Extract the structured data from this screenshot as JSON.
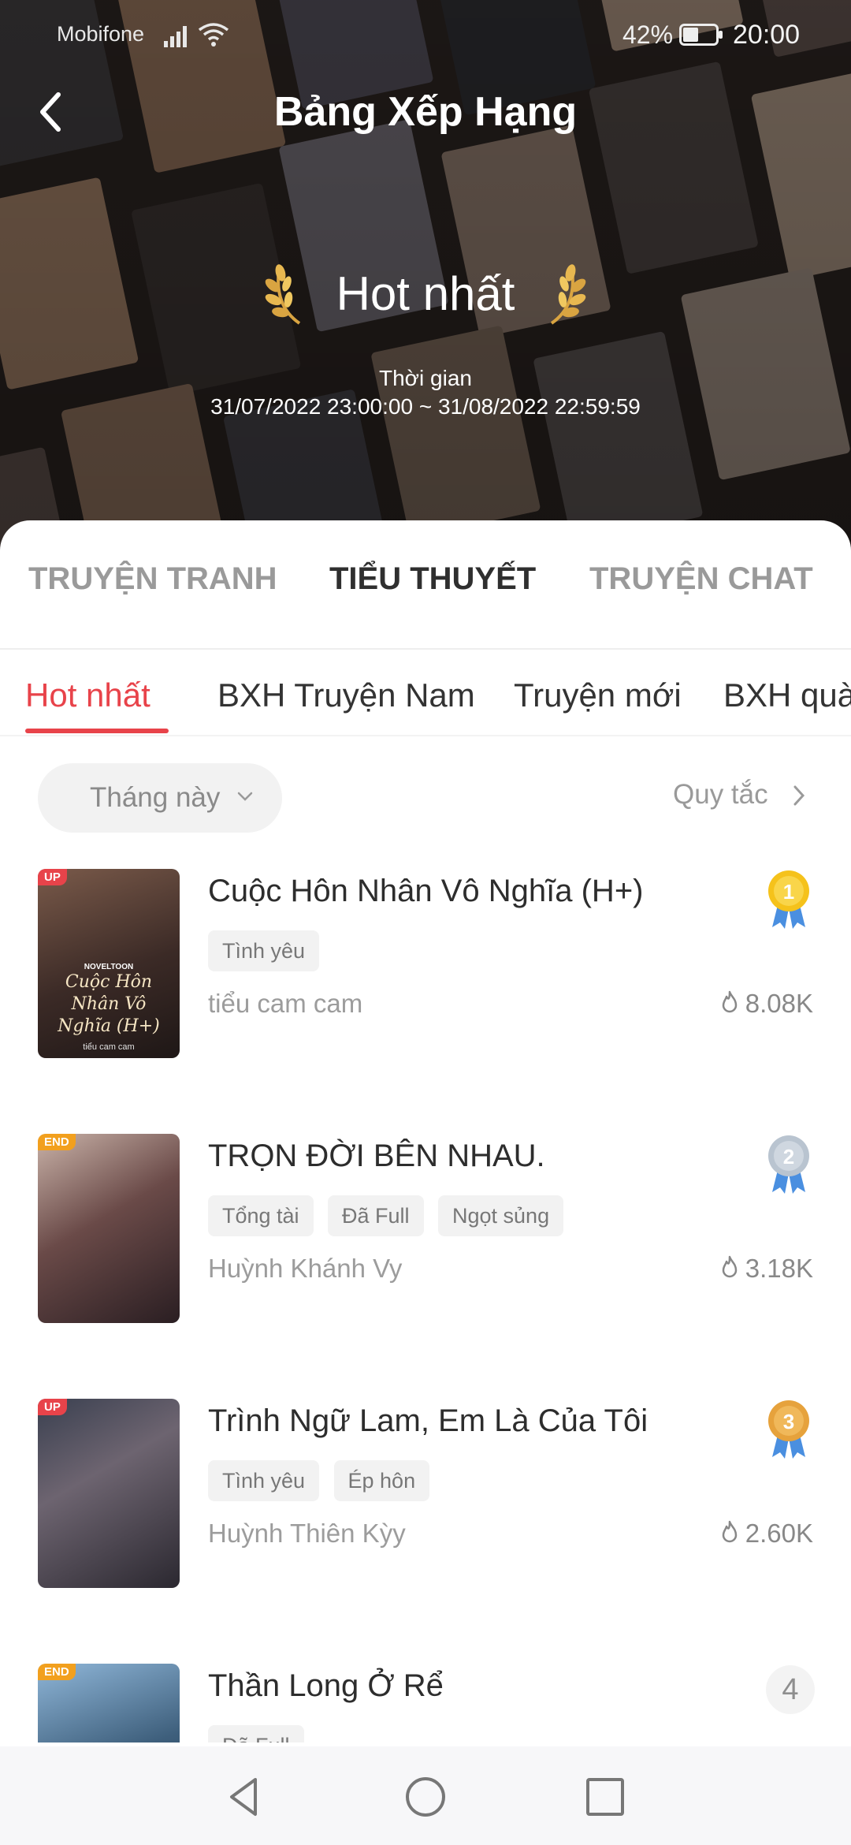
{
  "status_bar": {
    "carrier": "Mobifone",
    "battery_percent": "42%",
    "time": "20:00"
  },
  "header": {
    "title": "Bảng Xếp Hạng",
    "hero_title": "Hot nhất",
    "period_label": "Thời gian",
    "period_range": "31/07/2022 23:00:00 ~ 31/08/2022 22:59:59"
  },
  "main_tabs": [
    {
      "label": "TRUYỆN TRANH",
      "active": false
    },
    {
      "label": "TIỂU THUYẾT",
      "active": true
    },
    {
      "label": "TRUYỆN CHAT",
      "active": false
    }
  ],
  "sub_tabs": [
    {
      "label": "Hot nhất",
      "active": true
    },
    {
      "label": "BXH Truyện Nam",
      "active": false
    },
    {
      "label": "Truyện mới",
      "active": false
    },
    {
      "label": "BXH quà",
      "active": false
    }
  ],
  "filter": {
    "period_select": "Tháng này",
    "rules_link": "Quy tắc"
  },
  "rankings": [
    {
      "rank": "1",
      "title": "Cuộc Hôn Nhân Vô Nghĩa (H+)",
      "tags": [
        "Tình yêu"
      ],
      "author": "tiểu cam cam",
      "heat": "8.08K",
      "badge": "UP",
      "cover_text": "Cuộc Hôn Nhân Vô Nghĩa (H+)",
      "cover_brand": "NOVELTOON",
      "cover_author": "tiểu cam cam"
    },
    {
      "rank": "2",
      "title": "TRỌN ĐỜI BÊN NHAU.",
      "tags": [
        "Tổng tài",
        "Đã Full",
        "Ngọt sủng"
      ],
      "author": "Huỳnh Khánh Vy",
      "heat": "3.18K",
      "badge": "END"
    },
    {
      "rank": "3",
      "title": "Trình Ngữ Lam, Em Là Của Tôi",
      "tags": [
        "Tình yêu",
        "Ép hôn"
      ],
      "author": "Huỳnh Thiên Kỳy",
      "heat": "2.60K",
      "badge": "UP"
    },
    {
      "rank": "4",
      "title": "Thần Long Ở Rể",
      "tags": [
        "Đã Full"
      ],
      "badge": "END"
    }
  ],
  "colors": {
    "accent": "#e8434a",
    "gold": "#f5c21b",
    "silver": "#b9c4d0",
    "bronze": "#e6a23c",
    "ribbon": "#4a8fe0"
  },
  "icons": {
    "back": "back-arrow-icon",
    "laurel": "laurel-icon",
    "flame": "flame-icon",
    "medal": "medal-icon",
    "nav": [
      "nav-back-icon",
      "nav-home-icon",
      "nav-recents-icon"
    ]
  }
}
